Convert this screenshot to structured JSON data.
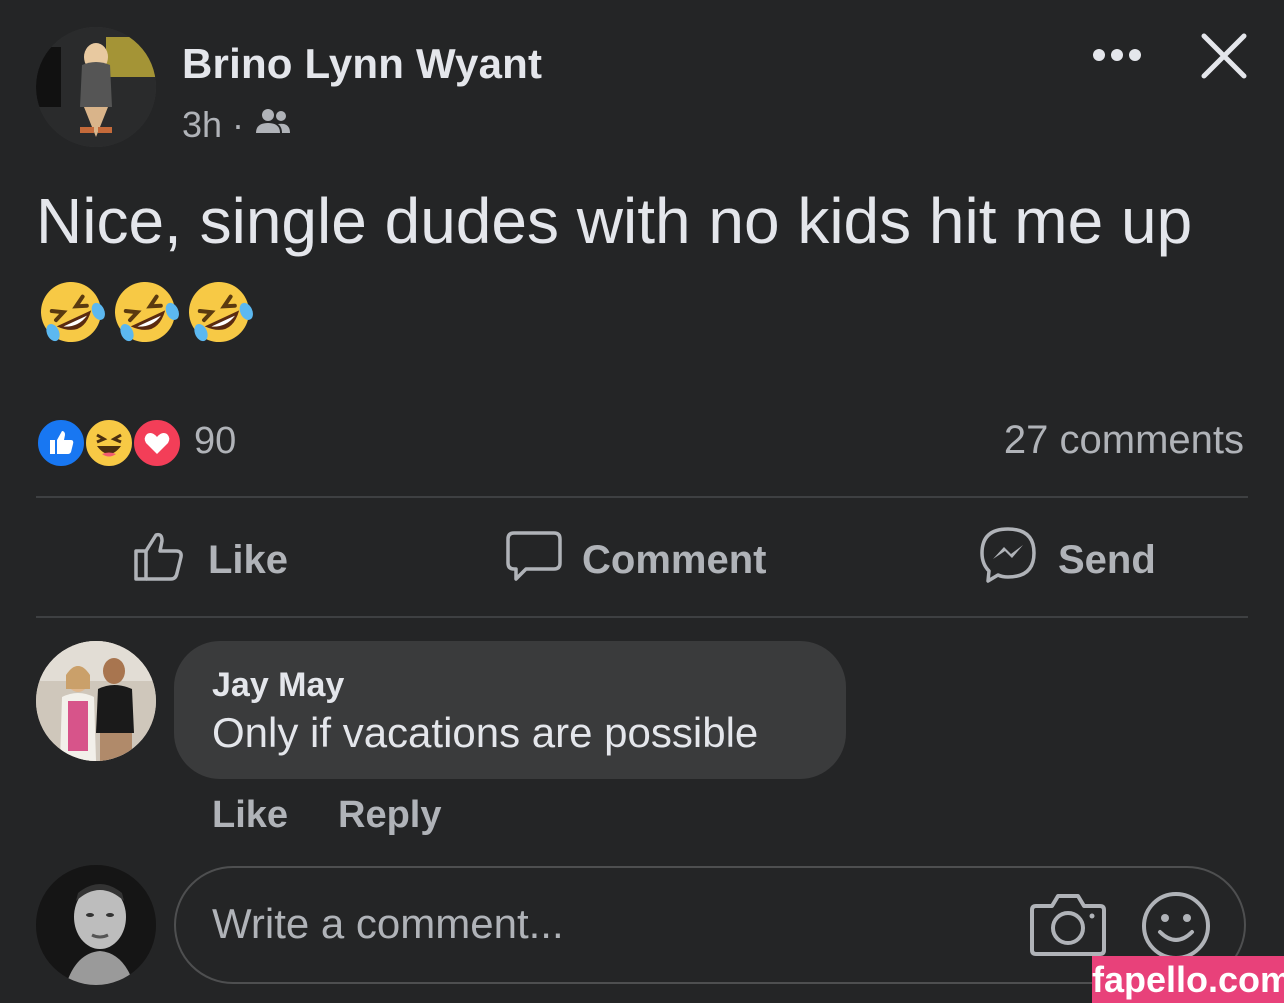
{
  "post": {
    "author": "Brino Lynn Wyant",
    "time": "3h",
    "separator": "·",
    "audience_icon": "friends-icon",
    "text": "Nice, single dudes with no kids hit me up",
    "emojis": [
      "rolling-on-floor-laughing",
      "rolling-on-floor-laughing",
      "rolling-on-floor-laughing"
    ]
  },
  "reactions": {
    "icons": [
      "like-icon",
      "haha-icon",
      "love-icon"
    ],
    "count": "90",
    "comments": "27 comments",
    "colors": {
      "like": "#1877f2",
      "haha": "#f7c945",
      "love": "#f33e58"
    }
  },
  "actions": {
    "like": "Like",
    "comment": "Comment",
    "send": "Send"
  },
  "comment": {
    "author": "Jay May",
    "text": "Only if vacations are possible",
    "like": "Like",
    "reply": "Reply"
  },
  "composer": {
    "placeholder": "Write a comment..."
  },
  "watermark": "fapello.com"
}
